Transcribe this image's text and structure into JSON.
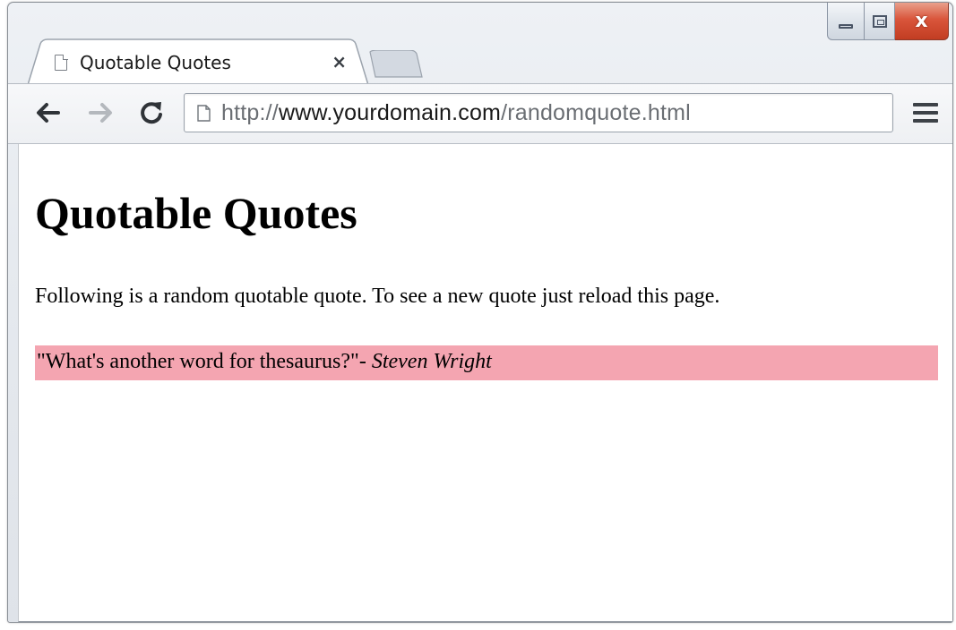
{
  "browser": {
    "tab": {
      "title": "Quotable Quotes",
      "close_glyph": "×"
    },
    "window_controls": {
      "close_glyph": "x"
    },
    "address_bar": {
      "scheme": "http://",
      "host": "www.yourdomain.com",
      "path": "/randomquote.html"
    }
  },
  "page": {
    "heading": "Quotable Quotes",
    "intro": "Following is a random quotable quote. To see a new quote just reload this page.",
    "quote": {
      "text": "\"What's another word for thesaurus?\"",
      "separator": "- ",
      "author": "Steven Wright",
      "highlight_color": "#f4a5b1"
    }
  },
  "icons": [
    "page-icon",
    "back-arrow-icon",
    "forward-arrow-icon",
    "reload-icon",
    "menu-icon",
    "minimize-icon",
    "maximize-icon",
    "close-icon"
  ]
}
